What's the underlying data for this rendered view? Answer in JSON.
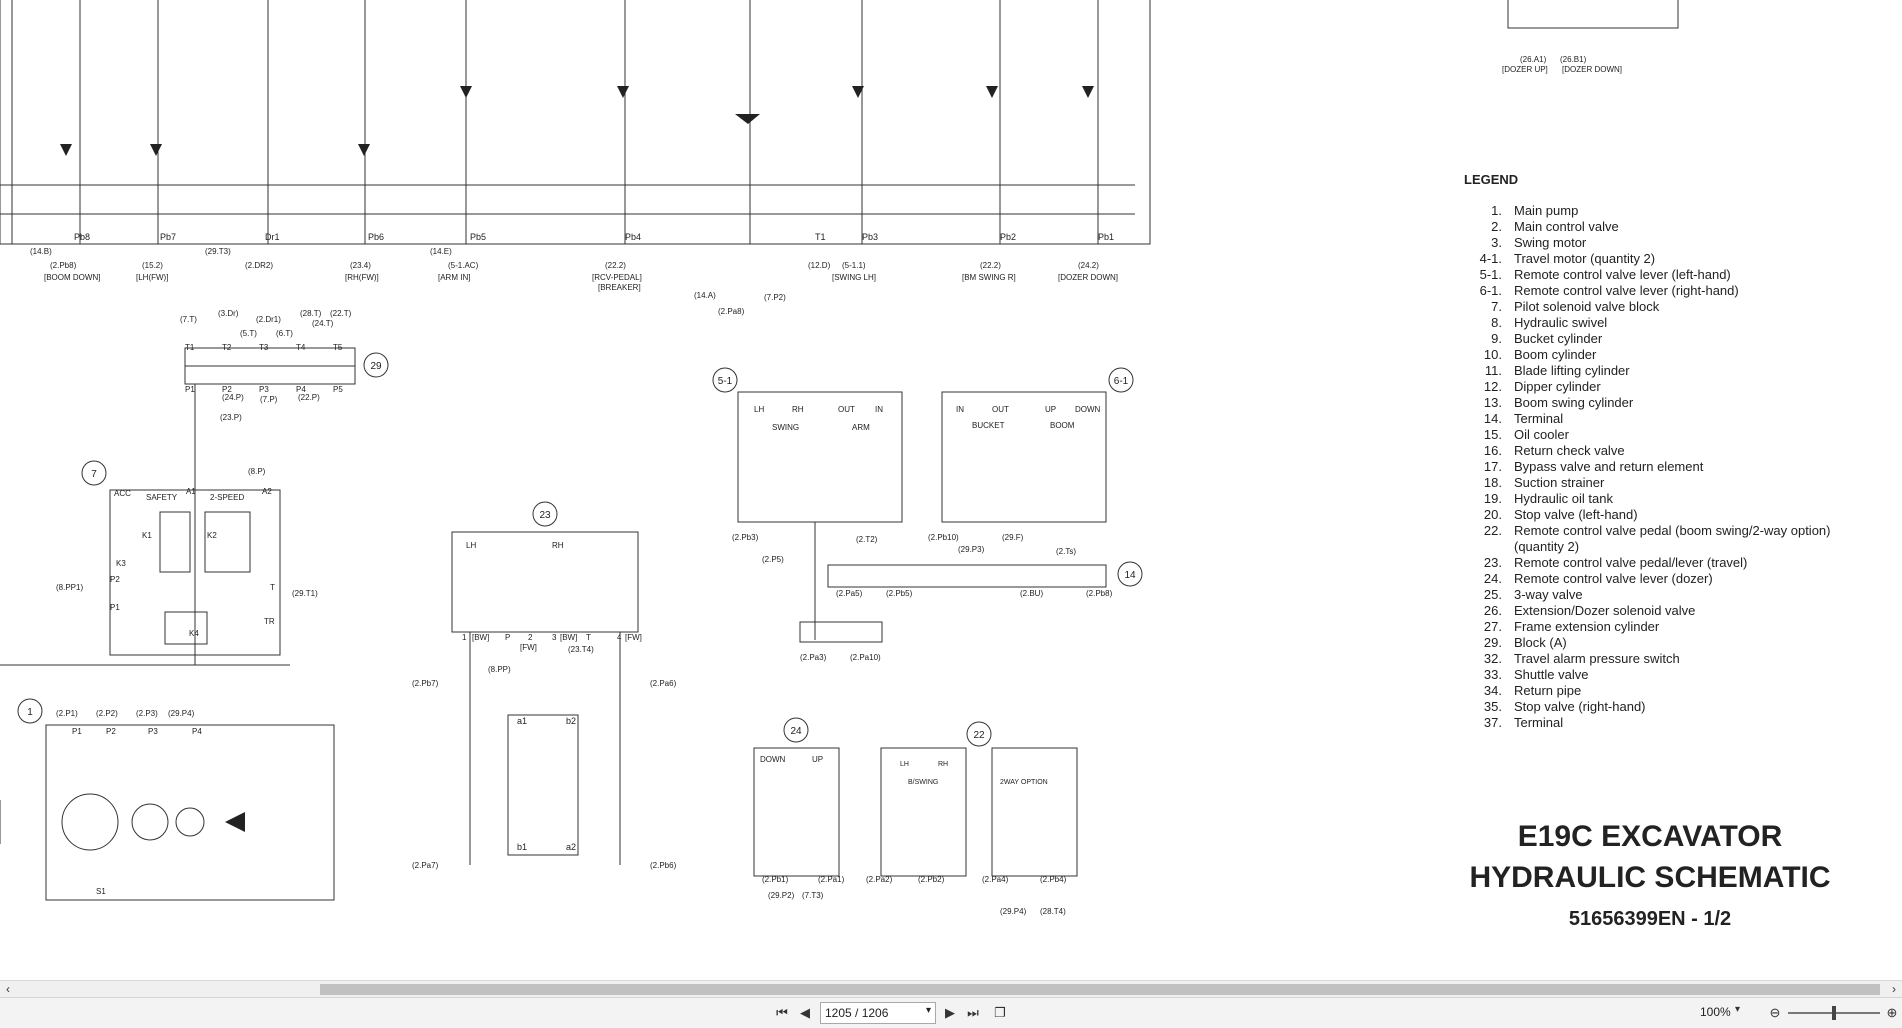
{
  "document": {
    "title_lines": [
      "E19C EXCAVATOR",
      "HYDRAULIC SCHEMATIC"
    ],
    "doc_number": "51656399EN - 1/2",
    "legend_title": "LEGEND",
    "legend": [
      {
        "num": "1.",
        "text": "Main pump"
      },
      {
        "num": "2.",
        "text": "Main control valve"
      },
      {
        "num": "3.",
        "text": "Swing motor"
      },
      {
        "num": "4-1.",
        "text": "Travel motor (quantity 2)"
      },
      {
        "num": "5-1.",
        "text": "Remote control valve lever (left-hand)"
      },
      {
        "num": "6-1.",
        "text": "Remote control valve lever (right-hand)"
      },
      {
        "num": "7.",
        "text": "Pilot solenoid valve block"
      },
      {
        "num": "8.",
        "text": "Hydraulic swivel"
      },
      {
        "num": "9.",
        "text": "Bucket cylinder"
      },
      {
        "num": "10.",
        "text": "Boom cylinder"
      },
      {
        "num": "11.",
        "text": "Blade lifting cylinder"
      },
      {
        "num": "12.",
        "text": "Dipper cylinder"
      },
      {
        "num": "13.",
        "text": "Boom swing cylinder"
      },
      {
        "num": "14.",
        "text": "Terminal"
      },
      {
        "num": "15.",
        "text": "Oil cooler"
      },
      {
        "num": "16.",
        "text": "Return check valve"
      },
      {
        "num": "17.",
        "text": "Bypass valve and return element"
      },
      {
        "num": "18.",
        "text": "Suction strainer"
      },
      {
        "num": "19.",
        "text": "Hydraulic oil tank"
      },
      {
        "num": "20.",
        "text": "Stop valve (left-hand)"
      },
      {
        "num": "22.",
        "text": "Remote control valve pedal (boom swing/2-way option)"
      },
      {
        "num": "",
        "text": "(quantity 2)"
      },
      {
        "num": "23.",
        "text": "Remote control valve pedal/lever (travel)"
      },
      {
        "num": "24.",
        "text": "Remote control valve lever (dozer)"
      },
      {
        "num": "25.",
        "text": "3-way valve"
      },
      {
        "num": "26.",
        "text": "Extension/Dozer solenoid valve"
      },
      {
        "num": "27.",
        "text": "Frame extension cylinder"
      },
      {
        "num": "29.",
        "text": "Block (A)"
      },
      {
        "num": "32.",
        "text": "Travel alarm pressure switch"
      },
      {
        "num": "33.",
        "text": "Shuttle valve"
      },
      {
        "num": "34.",
        "text": "Return pipe"
      },
      {
        "num": "35.",
        "text": "Stop valve (right-hand)"
      },
      {
        "num": "37.",
        "text": "Terminal"
      }
    ],
    "main_valve_ports": [
      "Pb8",
      "Pb7",
      "Dr1",
      "Pb6",
      "Pb5",
      "Pb4",
      "T1",
      "Pb3",
      "Pb2",
      "Pb1"
    ],
    "main_valve_refs": [
      "(14.B)",
      "(2.Pb8)",
      "[BOOM DOWN]",
      "(15.2)",
      "[LH(FW)]",
      "(29.T3)",
      "(2.DR2)",
      "(23.4)",
      "[RH(FW)]",
      "(14.E)",
      "(5-1.AC)",
      "[ARM IN]",
      "(22.2)",
      "[RCV-PEDAL]",
      "[BREAKER]",
      "(12.D)",
      "(5-1.1)",
      "[SWING LH]",
      "(22.2)",
      "[BM SWING R]",
      "(24.2)",
      "[DOZER DOWN]"
    ],
    "dozer_refs": [
      "(26.A1)",
      "(26.B1)",
      "[DOZER UP]",
      "[DOZER DOWN]"
    ],
    "component_numbers": [
      "29",
      "7",
      "23",
      "5-1",
      "6-1",
      "14",
      "1",
      "24",
      "22"
    ],
    "lever_labels_5_1": [
      "LH",
      "RH",
      "OUT",
      "IN",
      "SWING",
      "ARM"
    ],
    "lever_labels_6_1": [
      "IN",
      "OUT",
      "UP",
      "DOWN",
      "BUCKET",
      "BOOM"
    ],
    "block29_ports_top": [
      "T1",
      "T2",
      "T3",
      "T4",
      "T5"
    ],
    "block29_ports_bottom": [
      "P1",
      "P2",
      "P3",
      "P4",
      "P5"
    ],
    "valve7_labels": [
      "ACC",
      "SAFETY",
      "A1",
      "2-SPEED",
      "A2",
      "K1",
      "K2",
      "K3",
      "P2",
      "P1",
      "T",
      "TR",
      "K4"
    ],
    "valve23_labels": [
      "LH",
      "RH",
      "1",
      "[BW]",
      "P",
      "2",
      "3",
      "[BW]",
      "T",
      "4",
      "[FW]",
      "[FW]"
    ],
    "valve24_labels": [
      "DOWN",
      "UP"
    ],
    "valve22_labels": [
      "LH",
      "RH",
      "B/SWING",
      "2WAY OPTION"
    ],
    "pump1_ports": [
      "P1",
      "P2",
      "P3",
      "P4",
      "S1"
    ],
    "swivel_labels": [
      "a1",
      "b2",
      "b1",
      "a2"
    ],
    "misc_refs": [
      "(7.T)",
      "(3.Dr)",
      "(2.Dr1)",
      "(5.T)",
      "(6.T)",
      "(28.T)",
      "(24.T)",
      "(22.T)",
      "(8.P)",
      "(24.P)",
      "(22.P)",
      "(7.P)",
      "(23.P)",
      "(8.PP1)",
      "(29.T1)",
      "(2.P1)",
      "(2.P2)",
      "(2.P3)",
      "(29.P4)",
      "(8.PP)",
      "(23.T4)",
      "(2.Pb7)",
      "(2.Pa6)",
      "(2.Pa7)",
      "(2.Pb6)",
      "(2.Pb3)",
      "(2.T2)",
      "(2.P5)",
      "(2.Pb10)",
      "(29.F)",
      "(29.P3)",
      "(2.Ts)",
      "(2.Pa5)",
      "(2.Pb5)",
      "(2.BU)",
      "(2.Pb8)",
      "(2.Pa3)",
      "(2.Pa10)",
      "(14.A)",
      "(7.P2)",
      "(2.Pa8)",
      "(2.Pb1)",
      "(2.Pa1)",
      "(29.P2)",
      "(7.T3)",
      "(2.Pa2)",
      "(2.Pb2)",
      "(2.Pa4)",
      "(2.Pb4)",
      "(29.P4)",
      "(28.T4)"
    ]
  },
  "viewer": {
    "page_value": "1205 / 1206",
    "zoom_value": "100%",
    "icons": [
      "first-page-icon",
      "prev-page-icon",
      "next-page-icon",
      "last-page-icon",
      "page-view-icon",
      "zoom-out-icon",
      "zoom-in-icon"
    ]
  }
}
